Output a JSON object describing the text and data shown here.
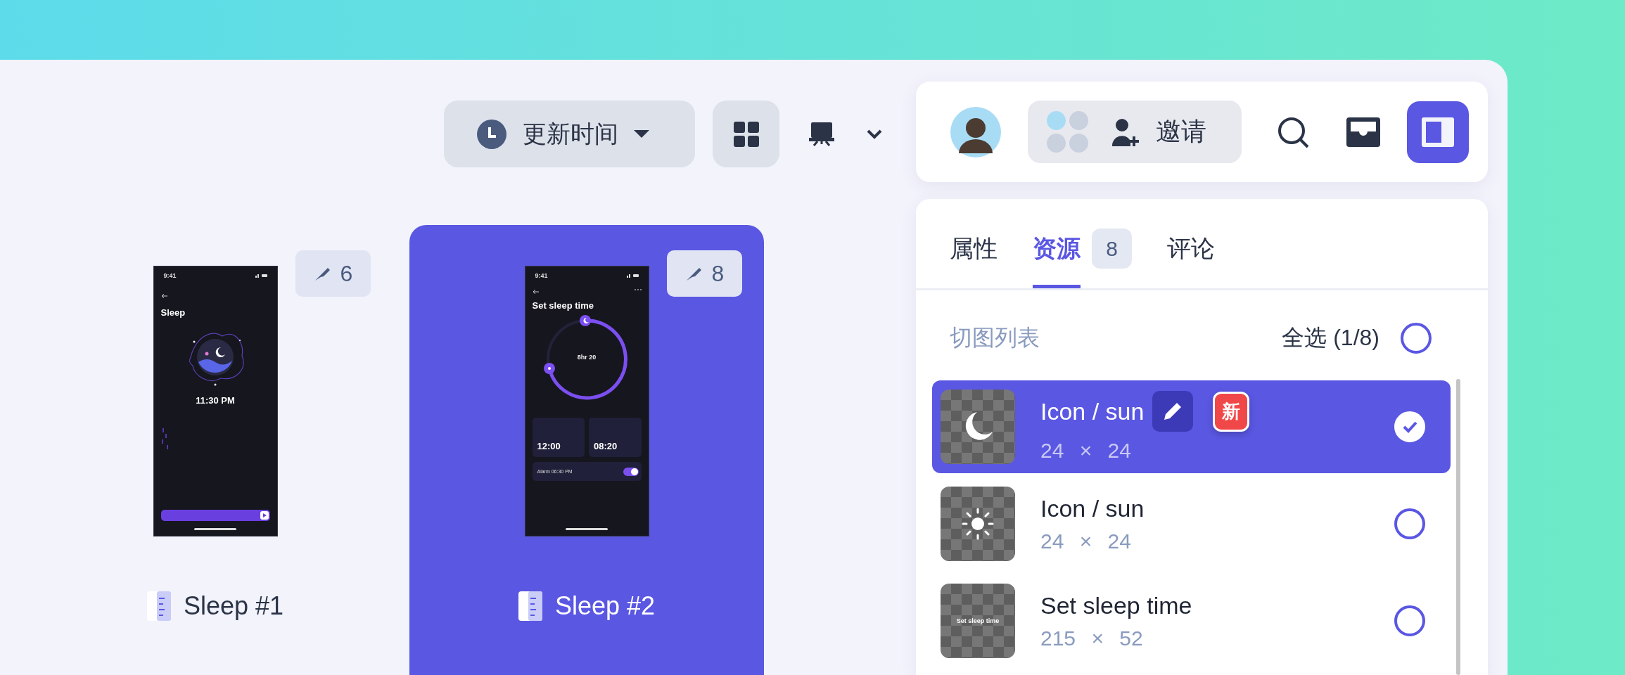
{
  "toolbar": {
    "sort_button": {
      "label": "更新时间"
    },
    "view_modes": [
      {
        "kind": "grid",
        "selected": true
      },
      {
        "kind": "present",
        "selected": false
      }
    ]
  },
  "artboards": [
    {
      "name": "Sleep #1",
      "slice_count": "6",
      "selected": false,
      "screen": {
        "kind": "sleep",
        "status_time": "9:41",
        "title": "Sleep",
        "time": "11:30 PM"
      }
    },
    {
      "name": "Sleep #2",
      "slice_count": "8",
      "selected": true,
      "screen": {
        "kind": "timer",
        "status_time": "9:41",
        "title": "Set sleep time",
        "duration": "8hr 20",
        "tiles": [
          "12:00",
          "08:20"
        ],
        "alarm": "Alarm 06:30 PM",
        "alarm_on": true
      }
    }
  ],
  "header": {
    "invite_button": {
      "label": "邀请"
    },
    "panel_toggle": {
      "on": true
    }
  },
  "tabs": [
    {
      "label": "属性",
      "selected": false
    },
    {
      "label": "资源",
      "selected": true,
      "badge": "8"
    },
    {
      "label": "评论",
      "selected": false
    }
  ],
  "slices": {
    "title": "切图列表",
    "select_all": {
      "label": "全选 (1/8)",
      "checked": false
    },
    "items": [
      {
        "kind": "moon",
        "name": "Icon / sun",
        "size": "24 × 24",
        "selected": true,
        "new_badge": "新"
      },
      {
        "kind": "sun",
        "name": "Icon / sun",
        "size": "24 × 24",
        "selected": false
      },
      {
        "kind": "text",
        "name": "Set sleep time",
        "size": "215 × 52",
        "selected": false,
        "preview_text": "Set sleep time"
      }
    ]
  }
}
